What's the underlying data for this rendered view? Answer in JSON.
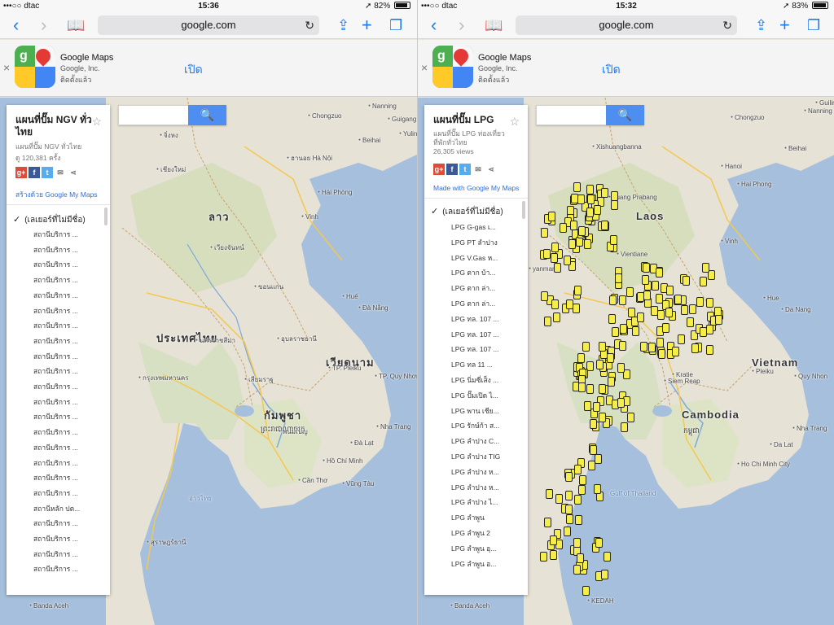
{
  "left": {
    "status": {
      "carrier": "•••○○ dtac",
      "time": "15:36",
      "battery": "82%",
      "battery_level": 0.82
    },
    "browser": {
      "url": "google.com"
    },
    "banner": {
      "app_name": "Google Maps",
      "developer": "Google, Inc.",
      "installed": "ติดตั้งแล้ว",
      "open_label": "เปิด"
    },
    "panel": {
      "title": "แผนที่ปั๊ม NGV ทั่วไทย",
      "description": "แผนที่ปั๊ม NGV ทั่วไทย",
      "views": "ดู 120,381 ครั้ง",
      "made_with": "สร้างด้วย Google My Maps",
      "layer": "(เลเยอร์ที่ไม่มีชื่อ)",
      "items": [
        "สถานีบริการ ...",
        "สถานีบริการ ...",
        "สถานีบริการ ...",
        "สถานีบริการ ...",
        "สถานีบริการ ...",
        "สถานีบริการ ...",
        "สถานีบริการ ...",
        "สถานีบริการ ...",
        "สถานีบริการ ...",
        "สถานีบริการ ...",
        "สถานีบริการ ...",
        "สถานีบริการ ...",
        "สถานีบริการ ...",
        "สถานีบริการ ...",
        "สถานีบริการ ...",
        "สถานีบริการ ...",
        "สถานีบริการ ...",
        "สถานีบริการ ...",
        "สถานีหลัก ปต...",
        "สถานีบริการ ...",
        "สถานีบริการ ...",
        "สถานีบริการ ...",
        "สถานีบริการ ..."
      ]
    },
    "map_labels": {
      "laos": "ลาว",
      "thailand": "ประเทศไทย",
      "vietnam": "เวียดนาม",
      "cambodia": "กัมพูชา",
      "cambodia_khmer": "ព្រះរាជាណាចក្រ",
      "hanoi": "ฮานอย Hà Nội",
      "bangkok": "กรุงเทพมหานคร",
      "phnom_penh": "พนมเปญ",
      "vientiane": "เวียงจันทน์",
      "hue": "Huế",
      "da_nang": "Đà Nẵng",
      "vinh": "Vinh",
      "hai_phong": "Hải Phòng",
      "ho_chi_minh": "Hồ Chí Minh",
      "chongzuo": "Chongzuo",
      "nanning": "Nanning",
      "guigang": "Guigang",
      "yulin": "Yulin",
      "beihai": "Beihai",
      "pleiku": "TP. Pleiku",
      "quy_nhon": "TP. Quy Nhơn",
      "siem_reap": "เสียมราฐ",
      "banda_aceh": "Banda Aceh",
      "nakhon_ratchasima": "นครราชสีมา",
      "khon_kaen": "ขอนแก่น",
      "ubon": "อุบลราชธานี",
      "chiang_mai": "เชียงใหม่",
      "surat": "สุราษฎร์ธานี",
      "gulf": "อ่าวไทย",
      "da_lat": "Đà Lạt",
      "vung_tau": "Vũng Tàu",
      "can_tho": "Cần Thơ",
      "nha_trang": "Nha Trang",
      "kunming": "จิ่งหง"
    }
  },
  "right": {
    "status": {
      "carrier": "•••○○ dtac",
      "time": "15:32",
      "battery": "83%",
      "battery_level": 0.83
    },
    "browser": {
      "url": "google.com"
    },
    "banner": {
      "app_name": "Google Maps",
      "developer": "Google, Inc.",
      "installed": "ติดตั้งแล้ว",
      "open_label": "เปิด"
    },
    "panel": {
      "title": "แผนที่ปั๊ม LPG",
      "description": "แผนที่ปั๊ม LPG ท่องเที่ยวที่พักทั่วไทย",
      "views": "26,305 views",
      "made_with": "Made with Google My Maps",
      "layer": "(เลเยอร์ที่ไม่มีชื่อ)",
      "items": [
        "LPG G-gas เ...",
        "LPG PT ลำปาง",
        "LPG V.Gas ห...",
        "LPG ตาก บ้า...",
        "LPG ตาก ล่า...",
        "LPG ตาก ล่า...",
        "LPG ทล. 107 ...",
        "LPG ทล. 107 ...",
        "LPG ทล. 107 ...",
        "LPG ทล 11 ...",
        "LPG นิ่มซี่เส็ง ...",
        "LPG ปั๊มเปิด ไ...",
        "LPG พาน เชีย...",
        "LPG รักษ์ก้า ส...",
        "LPG ลำปาง C...",
        "LPG ลำปาง TIG",
        "LPG ลำปาง ห...",
        "LPG ลำปาง ห...",
        "LPG ลำปาง ไ...",
        "LPG ลำพูน",
        "LPG ลำพูน 2",
        "LPG ลำพูน อุ...",
        "LPG ลำพูน อ..."
      ]
    },
    "map_labels": {
      "laos": "Laos",
      "vietnam": "Vietnam",
      "cambodia": "Cambodia",
      "cambodia_khmer": "កម្ពុជា",
      "hanoi": "Hanoi",
      "hai_phong": "Hai Phong",
      "vientiane": "Vientiane",
      "vinh": "Vinh",
      "hue": "Hue",
      "da_nang": "Da Nang",
      "pleiku": "Pleiku",
      "quy_nhon": "Quy Nhon",
      "siem_reap": "Siem Reap",
      "kratie": "Kratie",
      "nha_trang": "Nha Trang",
      "da_lat": "Da Lat",
      "ho_chi_minh": "Ho Chi Minh City",
      "gulf": "Gulf of Thailand",
      "banda_aceh": "Banda Aceh",
      "nanning": "Nanning",
      "guilin": "Guilin",
      "beihai": "Beihai",
      "luang_prabang": "Luang Prabang",
      "xishuangbanna": "Xishuangbanna",
      "myanmar": "yanmar",
      "kedah": "KEDAH",
      "chongzuo": "Chongzuo"
    }
  }
}
